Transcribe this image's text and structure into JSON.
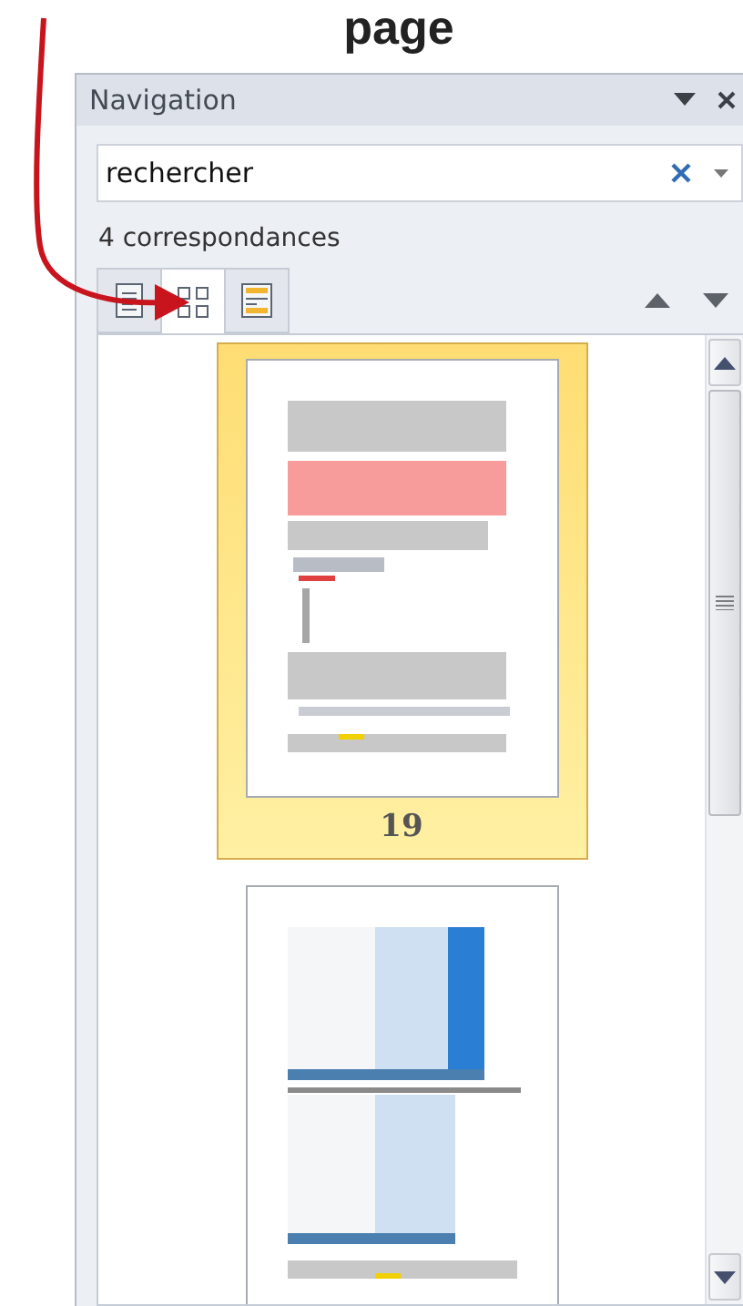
{
  "heading": "page",
  "pane": {
    "title": "Navigation",
    "search": {
      "value": "rechercher"
    },
    "match_count": "4 correspondances",
    "tabs": [
      {
        "kind": "headings",
        "selected": false
      },
      {
        "kind": "pages",
        "selected": true
      },
      {
        "kind": "results",
        "selected": false
      }
    ],
    "thumbnails": [
      {
        "kind": "text",
        "page_number": "19",
        "selected": true
      },
      {
        "kind": "screenshots",
        "selected": false
      }
    ]
  }
}
